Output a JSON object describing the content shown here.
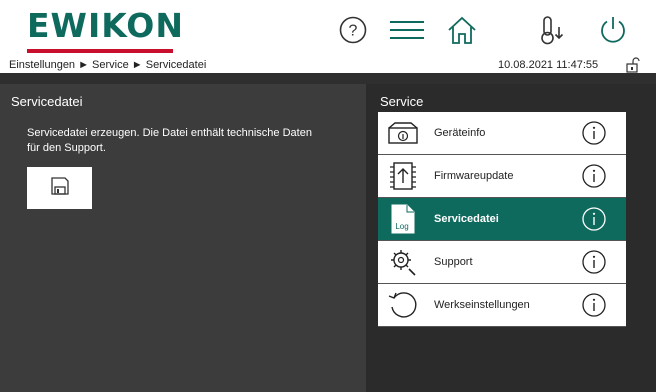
{
  "header": {
    "logo_text": "EWIKON",
    "breadcrumb": "Einstellungen ► Service ► Servicedatei",
    "datetime": "10.08.2021 11:47:55",
    "icons": [
      "help-icon",
      "menu-icon",
      "home-icon",
      "temperature-icon",
      "power-icon",
      "lock-icon"
    ]
  },
  "left": {
    "title": "Servicedatei",
    "description": "Servicedatei erzeugen. Die Datei enthält technische Daten für den Support.",
    "save_icon": "floppy-disk-icon"
  },
  "right": {
    "title": "Service",
    "items": [
      {
        "label": "Geräteinfo",
        "icon": "device-info-icon",
        "active": false
      },
      {
        "label": "Firmwareupdate",
        "icon": "firmware-update-icon",
        "active": false
      },
      {
        "label": "Servicedatei",
        "icon": "log-file-icon",
        "icon_text": "Log",
        "active": true
      },
      {
        "label": "Support",
        "icon": "support-gear-icon",
        "active": false
      },
      {
        "label": "Werkseinstellungen",
        "icon": "factory-reset-icon",
        "active": false
      }
    ],
    "info_icon": "info-icon"
  },
  "colors": {
    "brand_green": "#0f6a5e",
    "brand_red": "#c8102e",
    "left_panel": "#3c3c3c",
    "right_panel": "#2b2b2b"
  }
}
